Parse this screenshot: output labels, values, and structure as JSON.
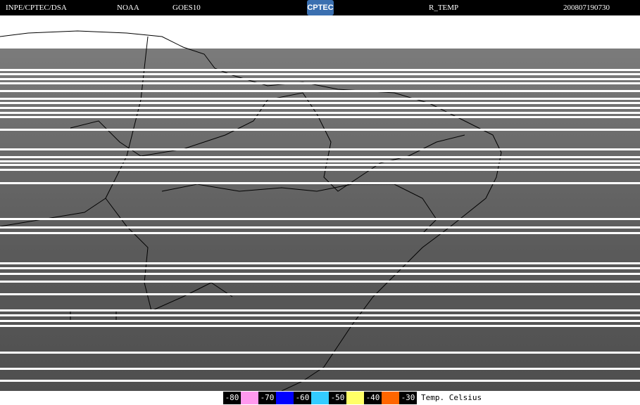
{
  "header": {
    "source": "INPE/CPTEC/DSA",
    "agency": "NOAA",
    "satellite": "GOES10",
    "logo": "CPTEC",
    "product": "R_TEMP",
    "timestamp": "200807190730"
  },
  "legend": {
    "entries": [
      {
        "label": "-80",
        "color": "#ff99ee"
      },
      {
        "label": "-70",
        "color": "#0000ff"
      },
      {
        "label": "-60",
        "color": "#33ccff"
      },
      {
        "label": "-50",
        "color": "#ffff66"
      },
      {
        "label": "-40",
        "color": "#ff6600"
      }
    ],
    "last_label": "-30",
    "unit": "Temp. Celsius"
  }
}
